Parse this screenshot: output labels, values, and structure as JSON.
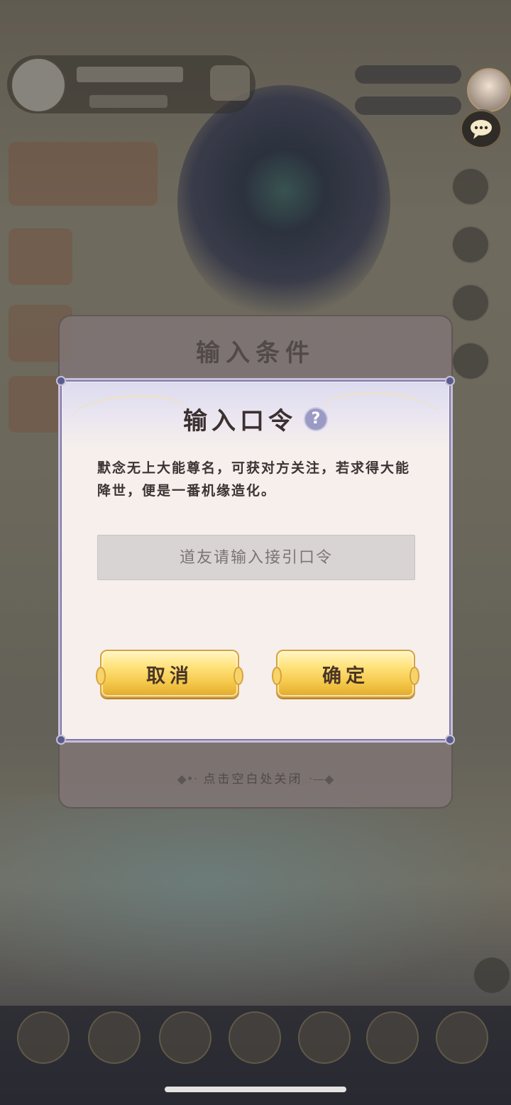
{
  "background": {
    "panel_title": "输入条件",
    "close_hint": "点击空白处关闭"
  },
  "dialog": {
    "title": "输入口令",
    "help_icon": "question-mark-icon",
    "description": "默念无上大能尊名，可获对方关注，若求得大能降世，便是一番机缘造化。",
    "input": {
      "placeholder": "道友请输入接引口令",
      "value": ""
    },
    "cancel_label": "取消",
    "confirm_label": "确定"
  },
  "icons": {
    "chat": "chat-bubble-icon",
    "avatar": "avatar"
  },
  "colors": {
    "dialog_bg": "#f6efec",
    "dialog_border": "#c7bfd9",
    "button_gold": "#f4c84a",
    "help_icon": "#9b9ac4"
  }
}
